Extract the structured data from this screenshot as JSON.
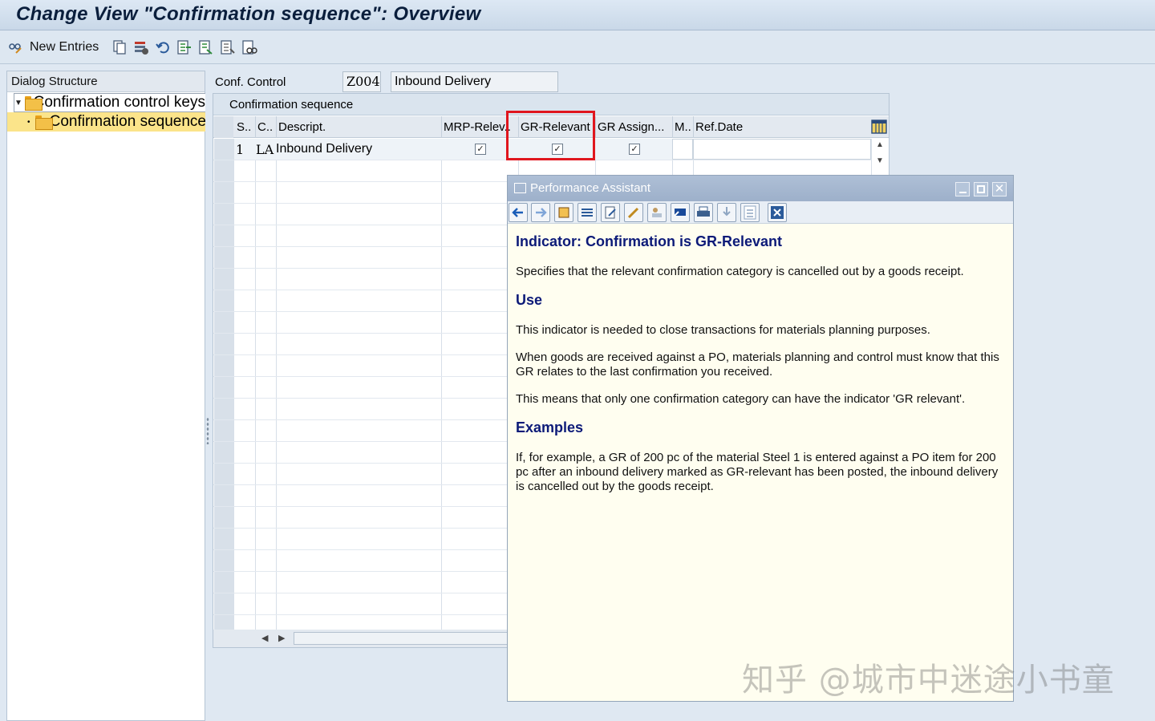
{
  "window": {
    "title": "Change View \"Confirmation sequence\": Overview"
  },
  "toolbar": {
    "new_entries_label": "New Entries"
  },
  "dialog_structure": {
    "header": "Dialog Structure",
    "items": [
      {
        "label": "Confirmation control keys",
        "expanded": true
      },
      {
        "label": "Confirmation sequence",
        "selected": true
      }
    ]
  },
  "conf_control": {
    "label": "Conf. Control",
    "value": "Z004",
    "description": "Inbound Delivery"
  },
  "table": {
    "title": "Confirmation sequence",
    "columns": [
      "S..",
      "C..",
      "Descript.",
      "MRP-Relev..",
      "GR-Relevant",
      "GR Assign...",
      "M..",
      "Ref.Date"
    ],
    "rows": [
      {
        "seq": "1",
        "cat": "LA",
        "descript": "Inbound Delivery",
        "mrp_relevant": true,
        "gr_relevant": true,
        "gr_assign": true,
        "m": "",
        "ref_date": ""
      }
    ],
    "highlight_color": "#e0161e"
  },
  "performance_assistant": {
    "title": "Performance Assistant",
    "heading": "Indicator: Confirmation is GR-Relevant",
    "intro": "Specifies that the relevant confirmation category is cancelled out by a goods receipt.",
    "use_heading": "Use",
    "use_p1": "This indicator is needed to close transactions for materials planning purposes.",
    "use_p2": "When goods are received against a PO, materials planning and control must know that this GR relates to the last confirmation you received.",
    "use_p3": "This means that only one confirmation category can have the indicator 'GR relevant'.",
    "examples_heading": "Examples",
    "examples_p1": "If, for example, a GR of 200 pc of the material Steel 1 is entered against a PO item for 200 pc after an inbound delivery marked as GR-relevant has been posted, the inbound delivery is cancelled out by the goods receipt."
  },
  "watermark": "知乎 @城市中迷途小书童"
}
